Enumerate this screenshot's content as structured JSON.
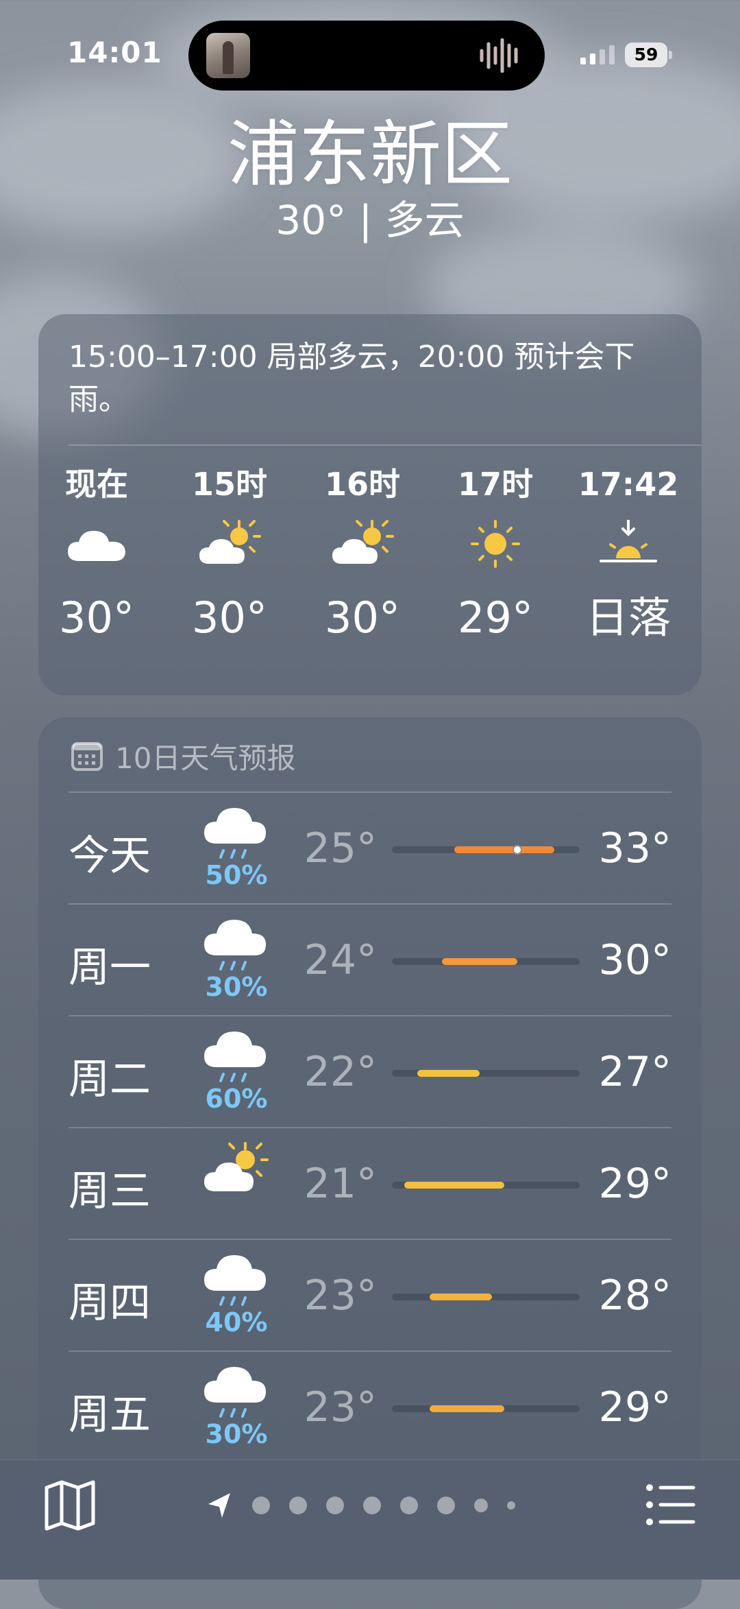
{
  "status_bar": {
    "time": "14:01",
    "battery": "59"
  },
  "header": {
    "city": "浦东新区",
    "current_line": "30° | 多云"
  },
  "hourly": {
    "summary": "15:00–17:00 局部多云，20:00 预计会下雨。",
    "items": [
      {
        "label": "现在",
        "icon": "cloud-icon",
        "temp": "30°"
      },
      {
        "label": "15时",
        "icon": "partly-cloudy-sun-icon",
        "temp": "30°"
      },
      {
        "label": "16时",
        "icon": "partly-cloudy-sun-icon",
        "temp": "30°"
      },
      {
        "label": "17时",
        "icon": "sun-icon",
        "temp": "29°"
      },
      {
        "label": "17:42",
        "icon": "sunset-icon",
        "temp": "日落"
      }
    ]
  },
  "daily": {
    "title": "10日天气预报",
    "range_scale": [
      20,
      35
    ],
    "days": [
      {
        "day": "今天",
        "icon": "rain-cloud-icon",
        "pop": "50%",
        "low": "25°",
        "high": "33°",
        "low_val": 25,
        "high_val": 33,
        "current_val": 30,
        "color": "#f08a3a"
      },
      {
        "day": "周一",
        "icon": "rain-cloud-icon",
        "pop": "30%",
        "low": "24°",
        "high": "30°",
        "low_val": 24,
        "high_val": 30,
        "color": "#f29a3c"
      },
      {
        "day": "周二",
        "icon": "rain-cloud-icon",
        "pop": "60%",
        "low": "22°",
        "high": "27°",
        "low_val": 22,
        "high_val": 27,
        "color": "#f3c33e"
      },
      {
        "day": "周三",
        "icon": "partly-cloudy-sun-icon",
        "pop": "",
        "low": "21°",
        "high": "29°",
        "low_val": 21,
        "high_val": 29,
        "color": "#f4bf3e"
      },
      {
        "day": "周四",
        "icon": "rain-cloud-icon",
        "pop": "40%",
        "low": "23°",
        "high": "28°",
        "low_val": 23,
        "high_val": 28,
        "color": "#f3b23c"
      },
      {
        "day": "周五",
        "icon": "rain-cloud-icon",
        "pop": "30%",
        "low": "23°",
        "high": "29°",
        "low_val": 23,
        "high_val": 29,
        "color": "#f3ab3b"
      }
    ]
  },
  "bottom_bar": {
    "page_count": 8,
    "left_icon": "map-icon",
    "right_icon": "list-icon"
  }
}
